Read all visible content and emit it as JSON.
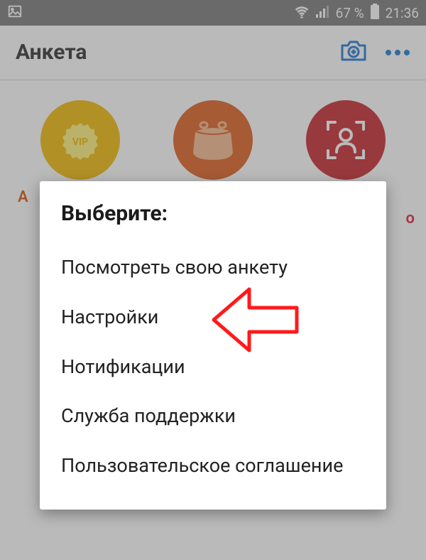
{
  "status": {
    "battery_pct": "67 %",
    "time": "21:36"
  },
  "header": {
    "title": "Анкета"
  },
  "partial_labels": {
    "left": "А",
    "right": "о"
  },
  "dialog": {
    "title": "Выберите:",
    "items": [
      "Посмотреть свою анкету",
      "Настройки",
      "Нотификации",
      "Служба поддержки",
      "Пользовательское соглашение"
    ]
  }
}
